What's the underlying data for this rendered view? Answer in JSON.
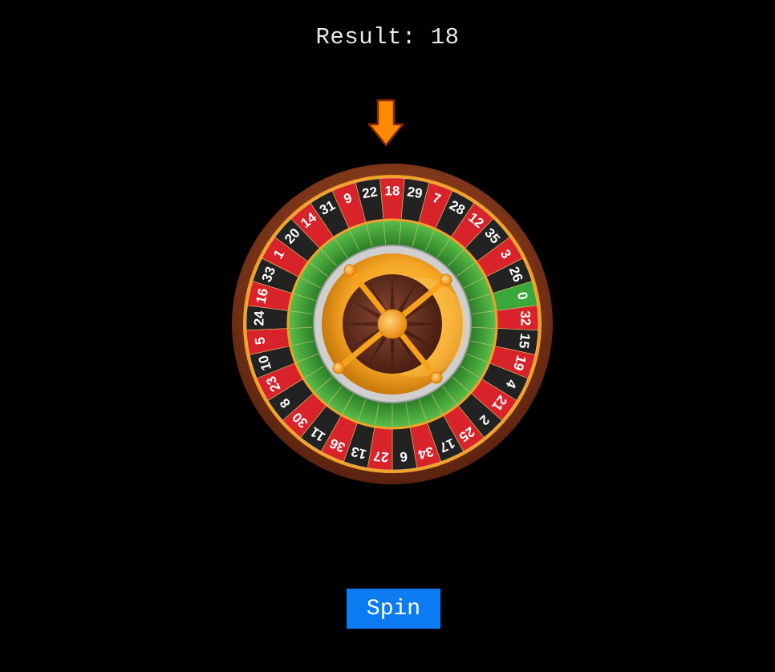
{
  "result": {
    "label": "Result:",
    "value": "18",
    "text": "Result: 18"
  },
  "pointer": {
    "icon": "down-arrow-icon",
    "color": "#ff8a00"
  },
  "wheel": {
    "numbers": [
      "0",
      "32",
      "15",
      "19",
      "4",
      "21",
      "2",
      "25",
      "17",
      "34",
      "6",
      "27",
      "13",
      "36",
      "11",
      "30",
      "8",
      "23",
      "10",
      "5",
      "24",
      "16",
      "33",
      "1",
      "20",
      "14",
      "31",
      "9",
      "22",
      "18",
      "29",
      "7",
      "28",
      "12",
      "35",
      "3",
      "26"
    ],
    "colors": {
      "red": "#d8232a",
      "black": "#222222",
      "green": "#3aa83a",
      "rim": "#7a3b1e",
      "gold": "#f3a12a"
    }
  },
  "controls": {
    "spin_label": "Spin",
    "spin_color": "#0d7cf2"
  }
}
